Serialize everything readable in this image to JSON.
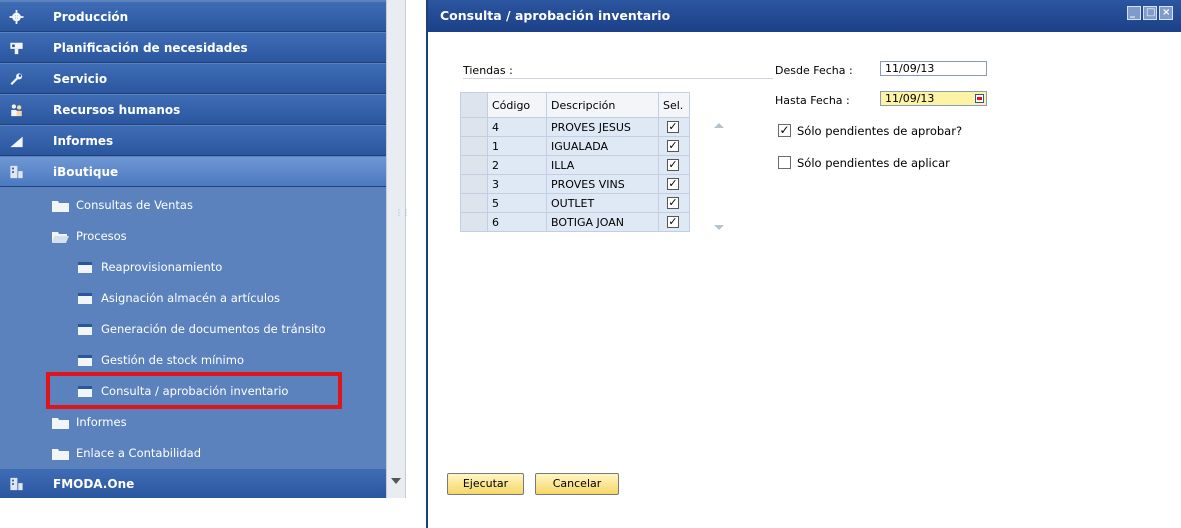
{
  "colors": {
    "nav_bg": "#5b82bd",
    "module_bar": "#2a569e",
    "module_active": "#4b79bf",
    "title_bar": "#1b4088",
    "highlight": "#e0151b",
    "button": "#f6d667"
  },
  "nav": {
    "modules": [
      {
        "label": "Producción",
        "icon": "gear-icon"
      },
      {
        "label": "Planificación de necesidades",
        "icon": "mrp-icon"
      },
      {
        "label": "Servicio",
        "icon": "wrench-icon"
      },
      {
        "label": "Recursos humanos",
        "icon": "people-icon"
      },
      {
        "label": "Informes",
        "icon": "chart-icon"
      },
      {
        "label": "iBoutique",
        "icon": "boutique-icon"
      }
    ],
    "iboutique": {
      "consultas_ventas": "Consultas de Ventas",
      "procesos": "Procesos",
      "procesos_items": [
        "Reaprovisionamiento",
        "Asignación almacén a artículos",
        "Generación de documentos de tránsito",
        "Gestión de stock mínimo",
        "Consulta / aprobación inventario"
      ],
      "informes": "Informes",
      "enlace": "Enlace a Contabilidad"
    },
    "fmoda": "FMODA.One"
  },
  "window": {
    "title": "Consulta / aprobación inventario",
    "tiendas_label": "Tiendas :",
    "desde_label": "Desde Fecha :",
    "desde_value": "11/09/13",
    "hasta_label": "Hasta Fecha :",
    "hasta_value": "11/09/13",
    "pendientes_aprobar": {
      "label": "Sólo pendientes de aprobar?",
      "checked": true
    },
    "pendientes_aplicar": {
      "label": "Sólo pendientes de aplicar",
      "checked": false
    },
    "table": {
      "headers": [
        "Código",
        "Descripción",
        "Sel."
      ],
      "rows": [
        {
          "code": "4",
          "desc": "PROVES JESUS",
          "sel": true
        },
        {
          "code": "1",
          "desc": "IGUALADA",
          "sel": true
        },
        {
          "code": "2",
          "desc": "ILLA",
          "sel": true
        },
        {
          "code": "3",
          "desc": "PROVES VINS",
          "sel": true
        },
        {
          "code": "5",
          "desc": "OUTLET",
          "sel": true
        },
        {
          "code": "6",
          "desc": "BOTIGA JOAN",
          "sel": true
        }
      ]
    },
    "buttons": {
      "ejecutar": "Ejecutar",
      "cancelar": "Cancelar"
    }
  }
}
